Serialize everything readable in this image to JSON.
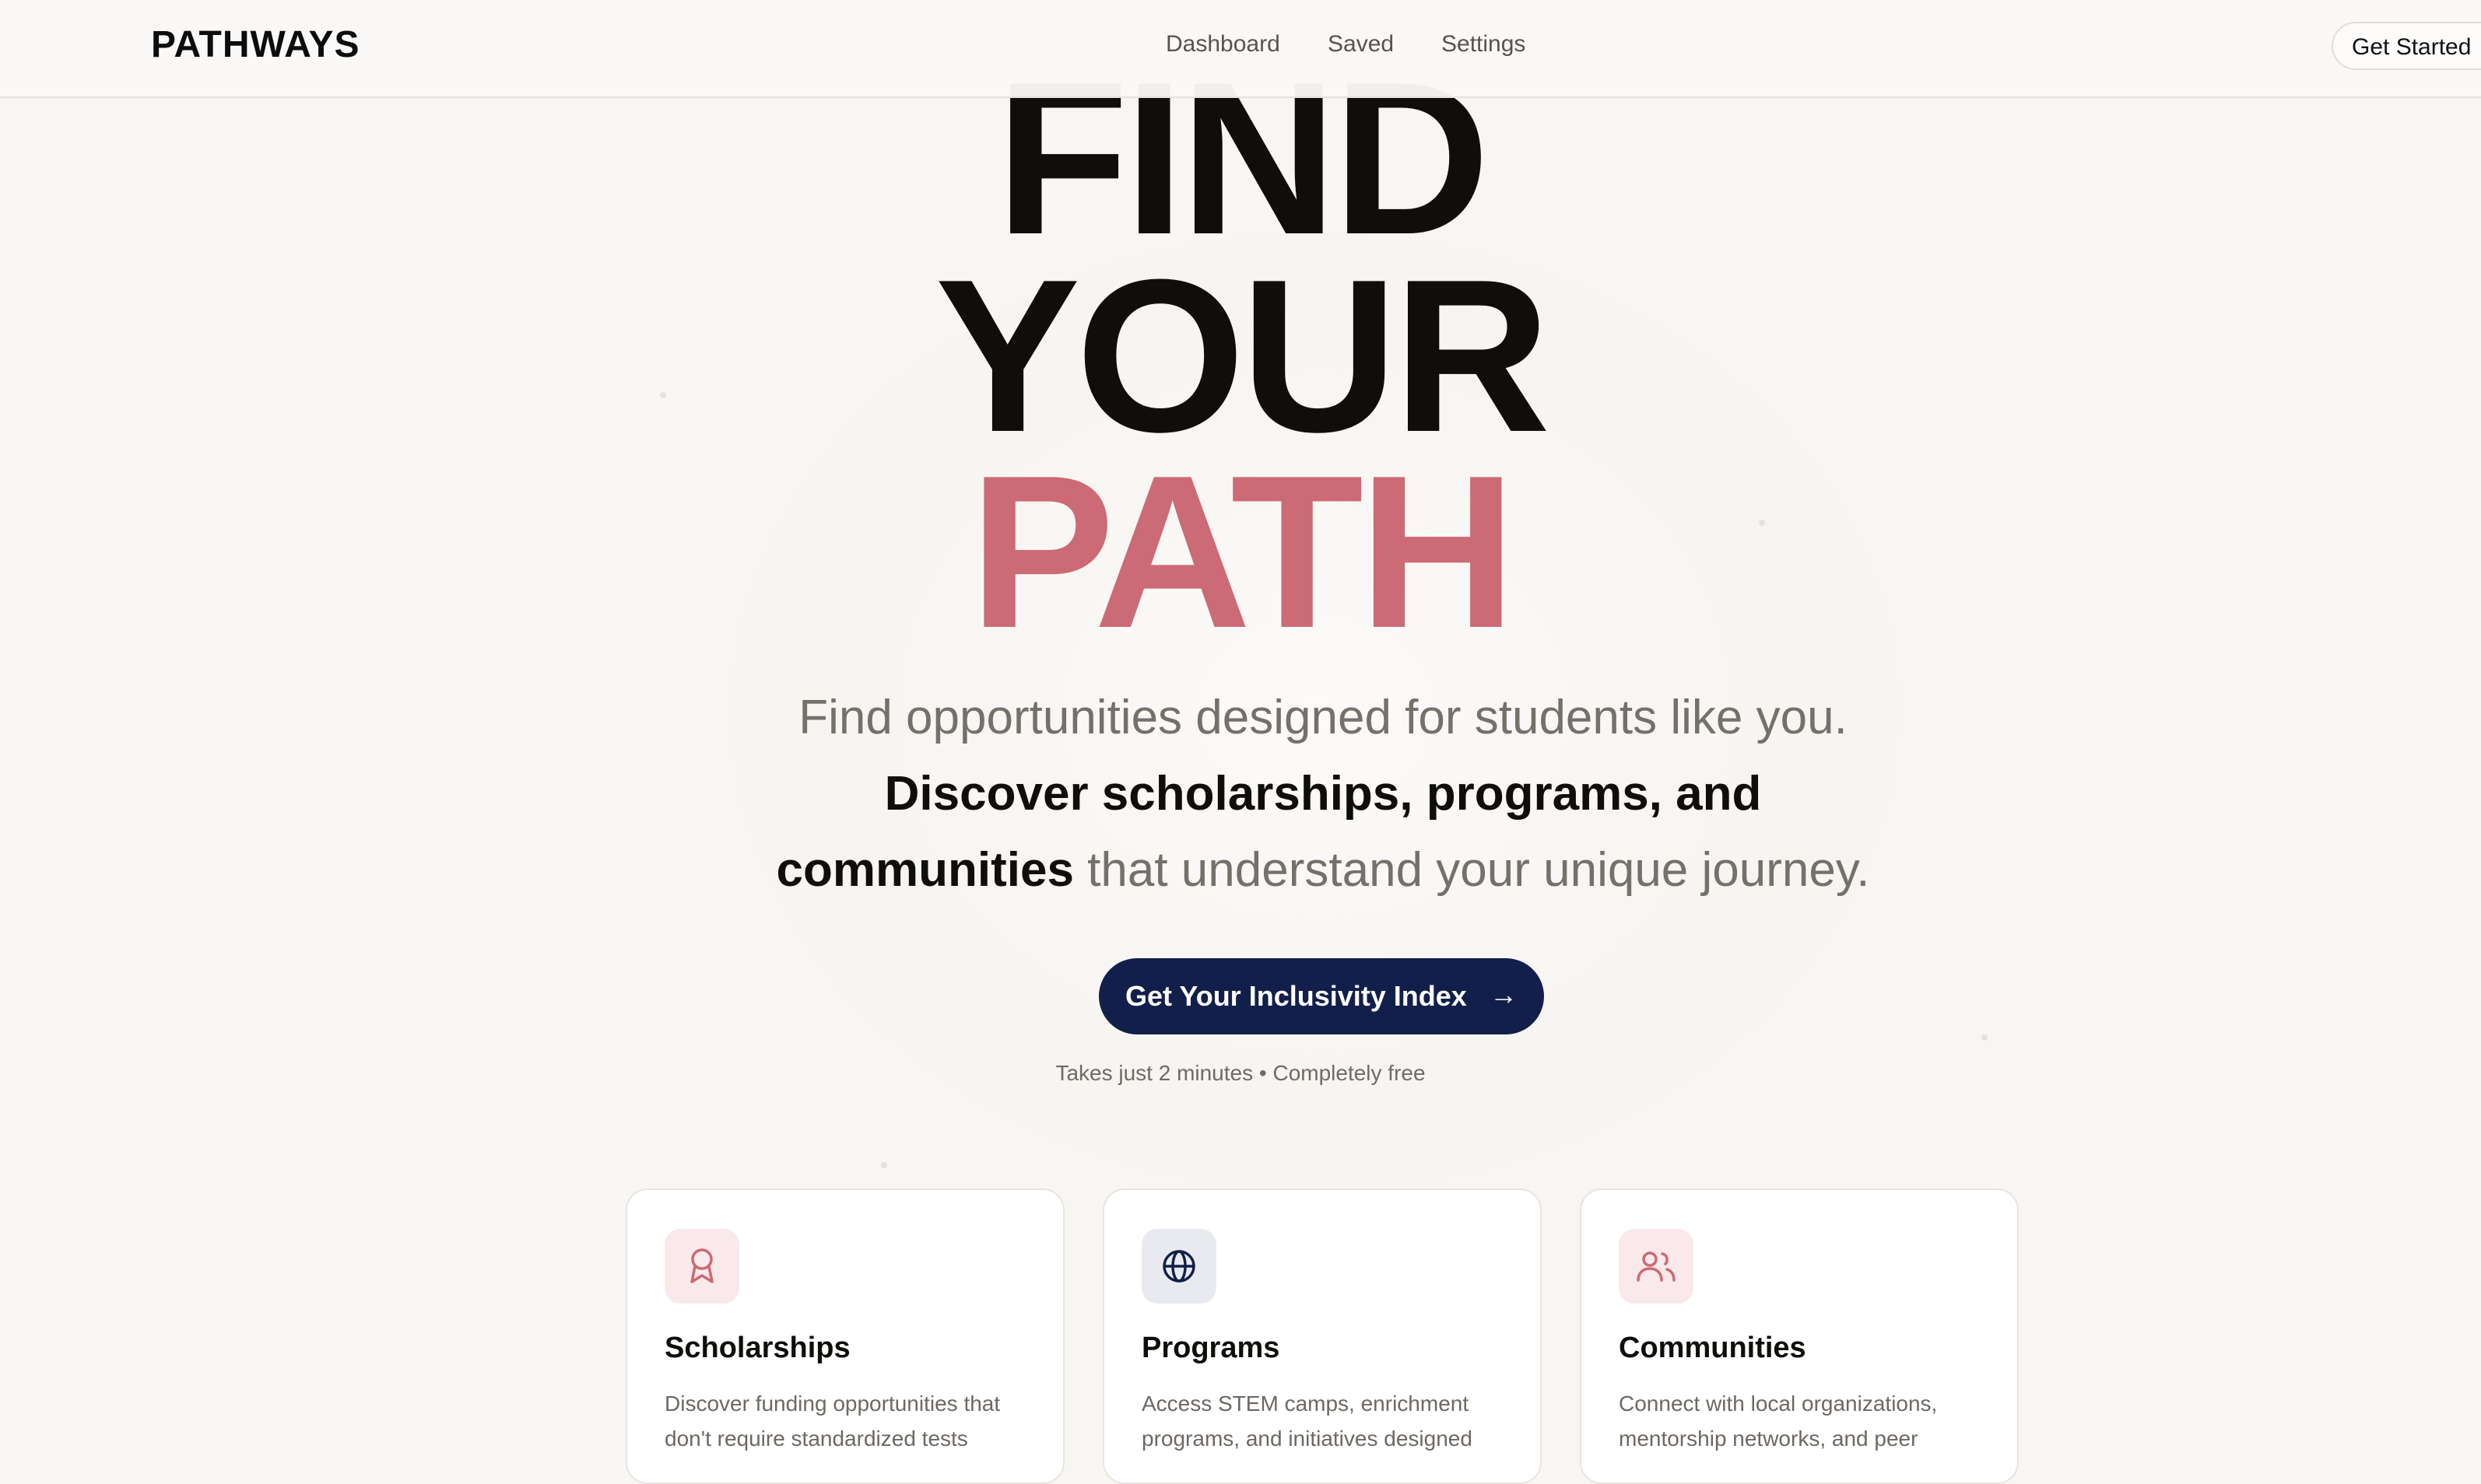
{
  "header": {
    "logo": "PATHWAYS",
    "nav": [
      "Dashboard",
      "Saved",
      "Settings"
    ],
    "cta": "Get Started"
  },
  "hero": {
    "line1": "FIND",
    "line2": "YOUR",
    "line3": "PATH",
    "accent_color": "#cc6a75",
    "subtitle_part1": "Find opportunities designed for students like you. ",
    "subtitle_bold": "Discover scholarships, programs, and communities",
    "subtitle_part2": " that understand your unique journey.",
    "cta_label": "Get Your Inclusivity Index",
    "cta_icon": "arrow-right-icon",
    "cta_color": "#121f4a",
    "note": "Takes just 2 minutes • Completely free"
  },
  "cards": [
    {
      "icon": "award-ribbon-icon",
      "title": "Scholarships",
      "description": "Discover funding opportunities that don't require standardized tests"
    },
    {
      "icon": "globe-icon",
      "title": "Programs",
      "description": "Access STEM camps, enrichment programs, and initiatives designed"
    },
    {
      "icon": "users-icon",
      "title": "Communities",
      "description": "Connect with local organizations, mentorship networks, and peer"
    }
  ]
}
